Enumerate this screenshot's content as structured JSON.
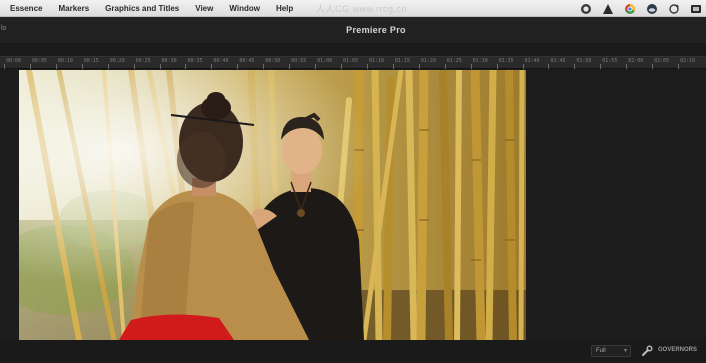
{
  "menubar": {
    "items": [
      "Essence",
      "Markers",
      "Graphics and Titles",
      "View",
      "Window",
      "Help"
    ],
    "watermark": "人人CG www.rrcg.cn",
    "status_icons": [
      "apple-icon",
      "triangle-icon",
      "chrome-icon",
      "cloud-icon",
      "refresh-icon",
      "battery-icon"
    ]
  },
  "titlebar": {
    "left_label": "lo",
    "title": "Premiere Pro"
  },
  "ruler": {
    "labels": [
      "00:00",
      "00:05",
      "00:10",
      "00:15",
      "00:20",
      "00:25",
      "00:30",
      "00:35",
      "00:40",
      "00:45",
      "00:50",
      "00:55",
      "01:00",
      "01:05",
      "01:10",
      "01:15",
      "01:20",
      "01:25",
      "01:30",
      "01:35",
      "01:40",
      "01:45",
      "01:50",
      "01:55",
      "02:00",
      "02:05",
      "02:10"
    ]
  },
  "monitor": {
    "scene": "bamboo-forest-hair-styling"
  },
  "bottom": {
    "fit_value": "Full",
    "label": "GOVERNORS"
  },
  "colors": {
    "menubar": "#e6e6e6",
    "panel": "#1b1b1b",
    "bamboo": "#c9a94c"
  }
}
